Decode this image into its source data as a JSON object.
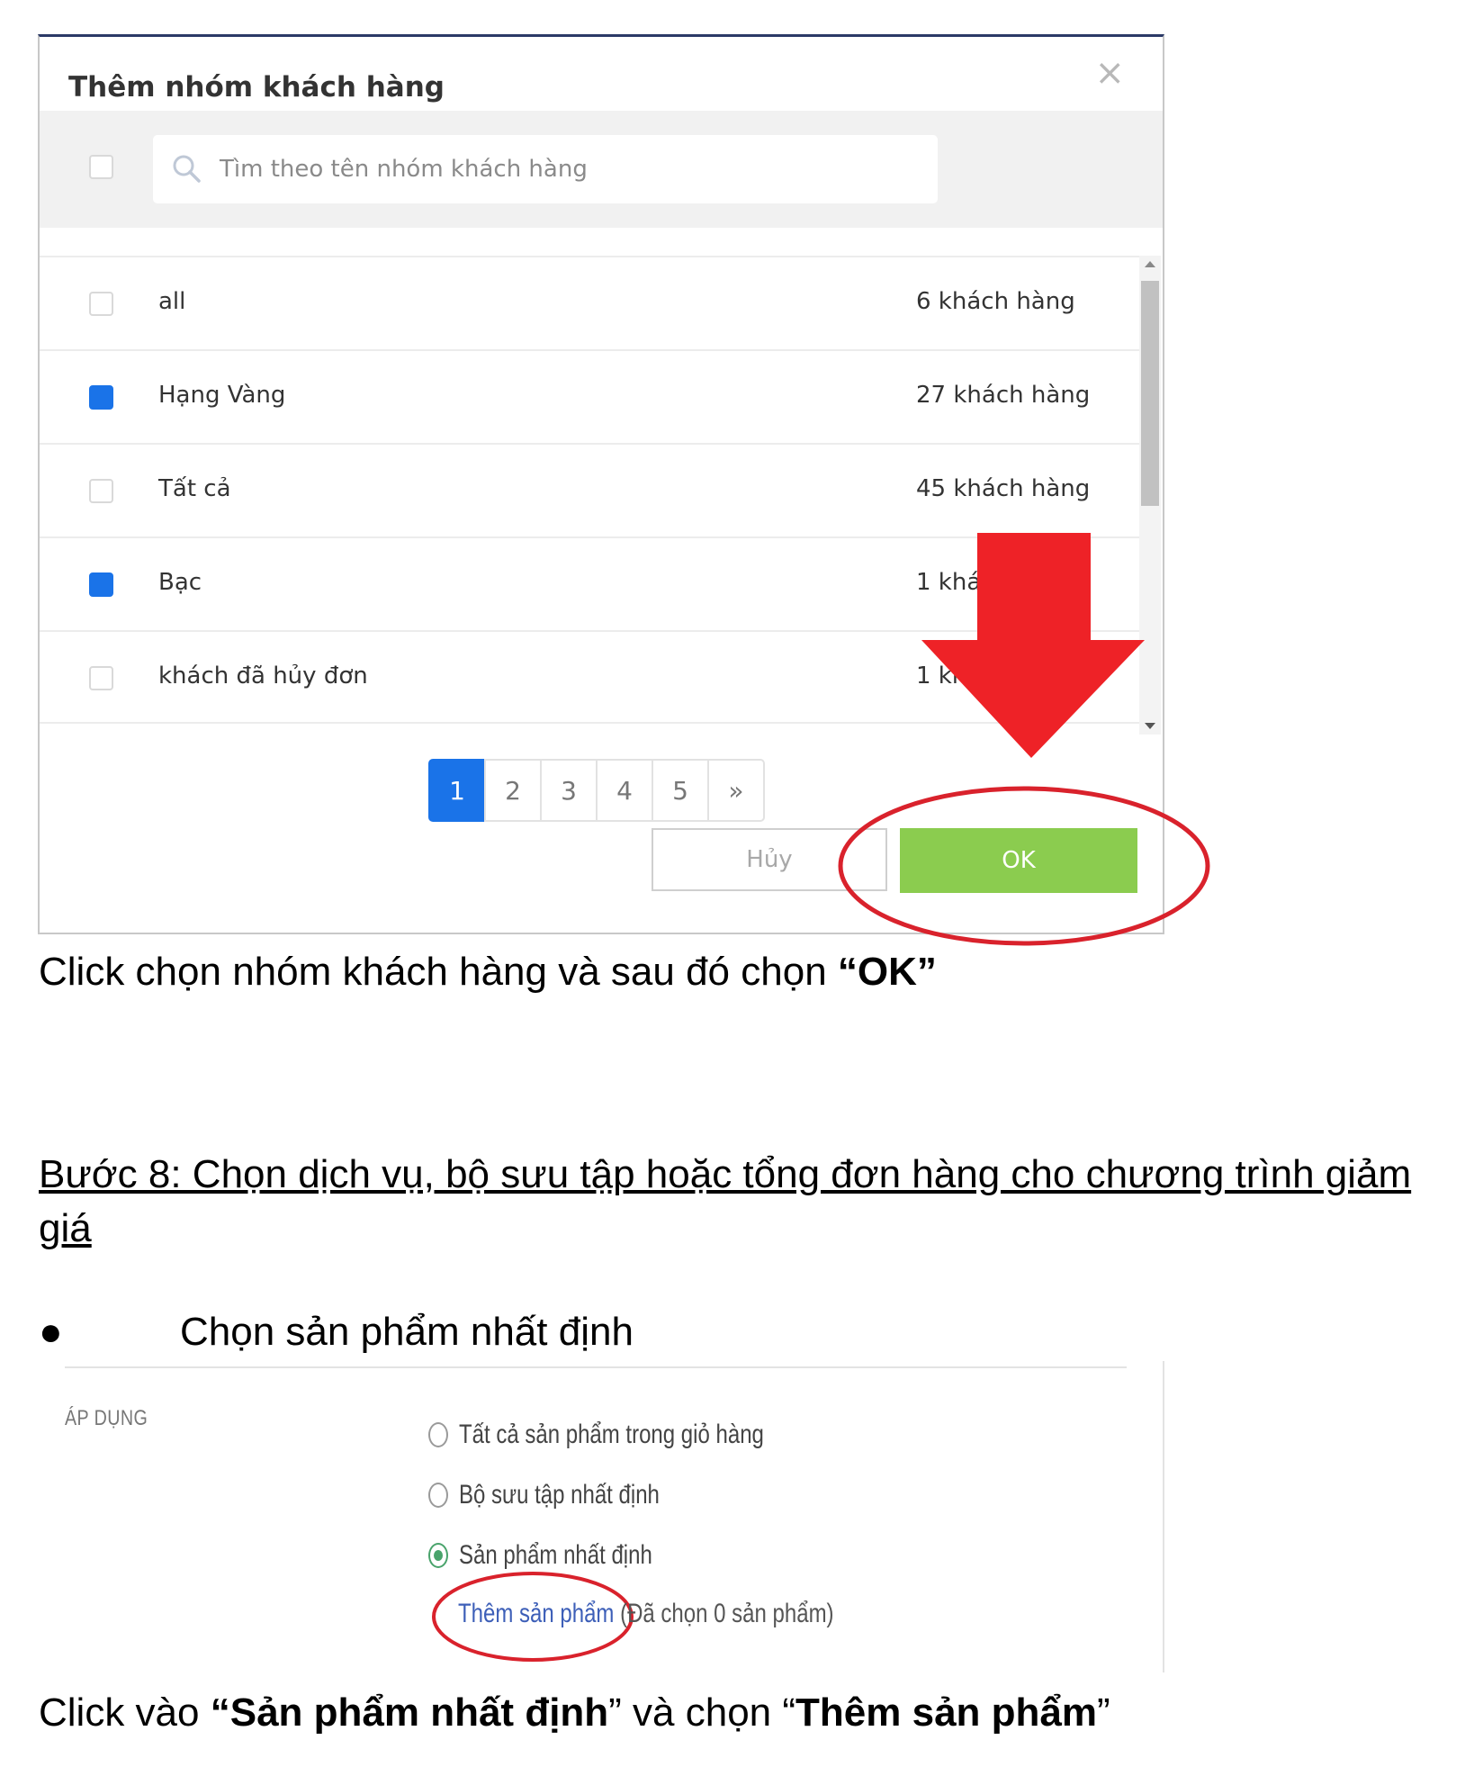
{
  "modal": {
    "title": "Thêm nhóm khách hàng",
    "close_symbol": "×",
    "search_placeholder": "Tìm theo tên nhóm khách hàng",
    "rows": [
      {
        "name": "all",
        "count": "6 khách hàng",
        "checked": false
      },
      {
        "name": "Hạng Vàng",
        "count": "27 khách hàng",
        "checked": true
      },
      {
        "name": "Tất cả",
        "count": "45 khách hàng",
        "checked": false
      },
      {
        "name": "Bạc",
        "count": "1 khá",
        "checked": true
      },
      {
        "name": "khách đã hủy đơn",
        "count": "1 kh",
        "checked": false
      }
    ],
    "pagination": {
      "pages": [
        "1",
        "2",
        "3",
        "4",
        "5"
      ],
      "next": "»",
      "current": "1"
    },
    "cancel_label": "Hủy",
    "ok_label": "OK"
  },
  "annotation_colors": {
    "arrow": "#ee2227",
    "circle": "#d9222c",
    "accent_blue": "#1a73e8",
    "ok_green": "#8bcc4f"
  },
  "caption1": {
    "text": "Click chọn nhóm khách hàng và sau đó chọn ",
    "bold": "“OK”"
  },
  "step8_heading": "Bước 8: Chọn dịch vụ, bộ sưu tập hoặc tổng đơn hàng cho chương trình giảm giá",
  "bullet": {
    "symbol": "●",
    "text": "Chọn sản phẩm nhất định"
  },
  "apply_panel": {
    "label": "ÁP DỤNG",
    "options": [
      {
        "label": "Tất cả sản phẩm trong giỏ hàng",
        "selected": false
      },
      {
        "label": "Bộ sưu tập nhất định",
        "selected": false
      },
      {
        "label": "Sản phẩm nhất định",
        "selected": true
      }
    ],
    "add_link": "Thêm sản phẩm",
    "add_note": " (Đã chọn 0 sản phẩm)"
  },
  "caption2": {
    "p1": "Click vào ",
    "b1": "“Sản phẩm nhất định",
    "p2": "” và chọn “",
    "b2": "Thêm sản phẩm",
    "p3": "”"
  }
}
